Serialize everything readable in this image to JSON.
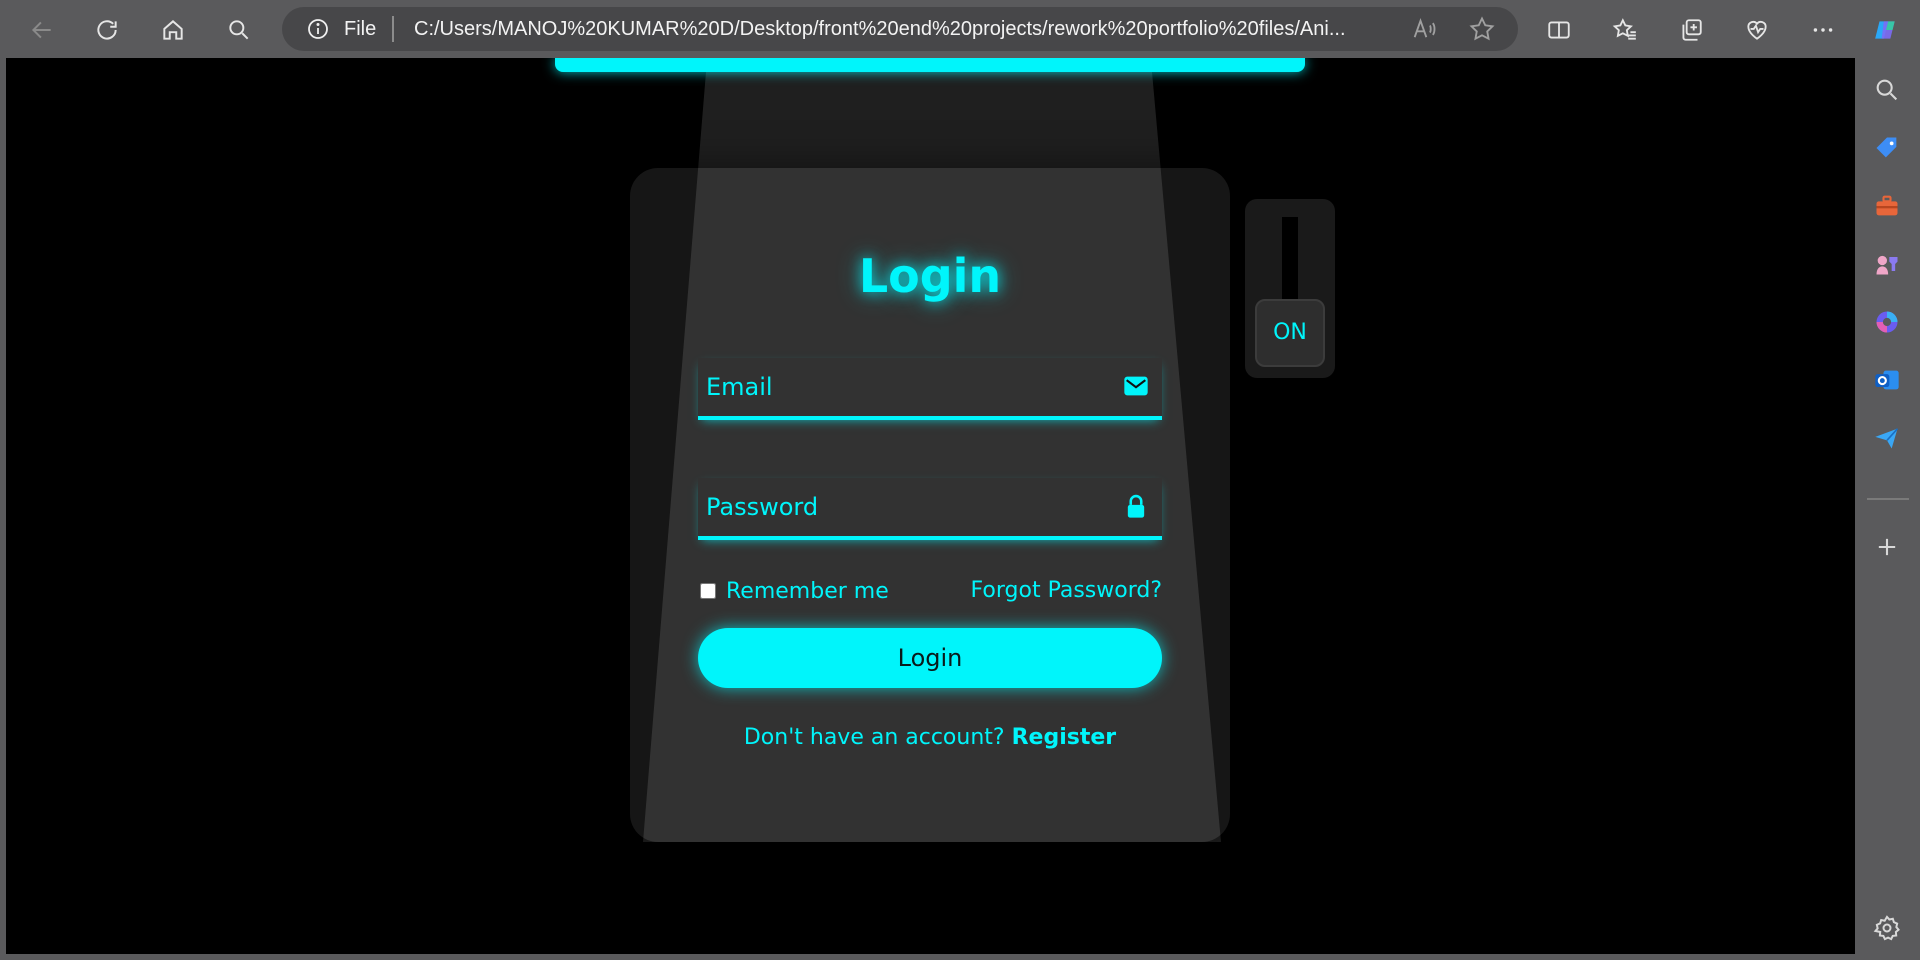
{
  "browser": {
    "address": {
      "scheme_label": "File",
      "url": "C:/Users/MANOJ%20KUMAR%20D/Desktop/front%20end%20projects/rework%20portfolio%20files/Ani..."
    },
    "toolbar_icons": [
      "back-icon",
      "refresh-icon",
      "home-icon",
      "search-icon",
      "info-icon",
      "read-aloud-icon",
      "favorite-star-icon",
      "split-screen-icon",
      "favorites-icon",
      "collections-icon",
      "browser-essentials-icon",
      "more-icon",
      "copilot-icon"
    ],
    "sidebar_icons": [
      "search-icon",
      "shopping-tag-icon",
      "tools-icon",
      "games-icon",
      "microsoft365-icon",
      "outlook-icon",
      "drop-icon",
      "add-icon",
      "settings-icon"
    ]
  },
  "page": {
    "title": "Login",
    "email": {
      "placeholder": "Email",
      "icon": "mail-icon"
    },
    "password": {
      "placeholder": "Password",
      "icon": "lock-icon"
    },
    "remember_label": "Remember me",
    "remember_checked": false,
    "forgot_label": "Forgot Password?",
    "login_button": "Login",
    "register_prompt": "Don't have an account?",
    "register_link": "Register",
    "toggle_label": "ON"
  },
  "colors": {
    "accent": "#00f5fb",
    "background": "#000000",
    "chrome": "#5a5a5c"
  }
}
